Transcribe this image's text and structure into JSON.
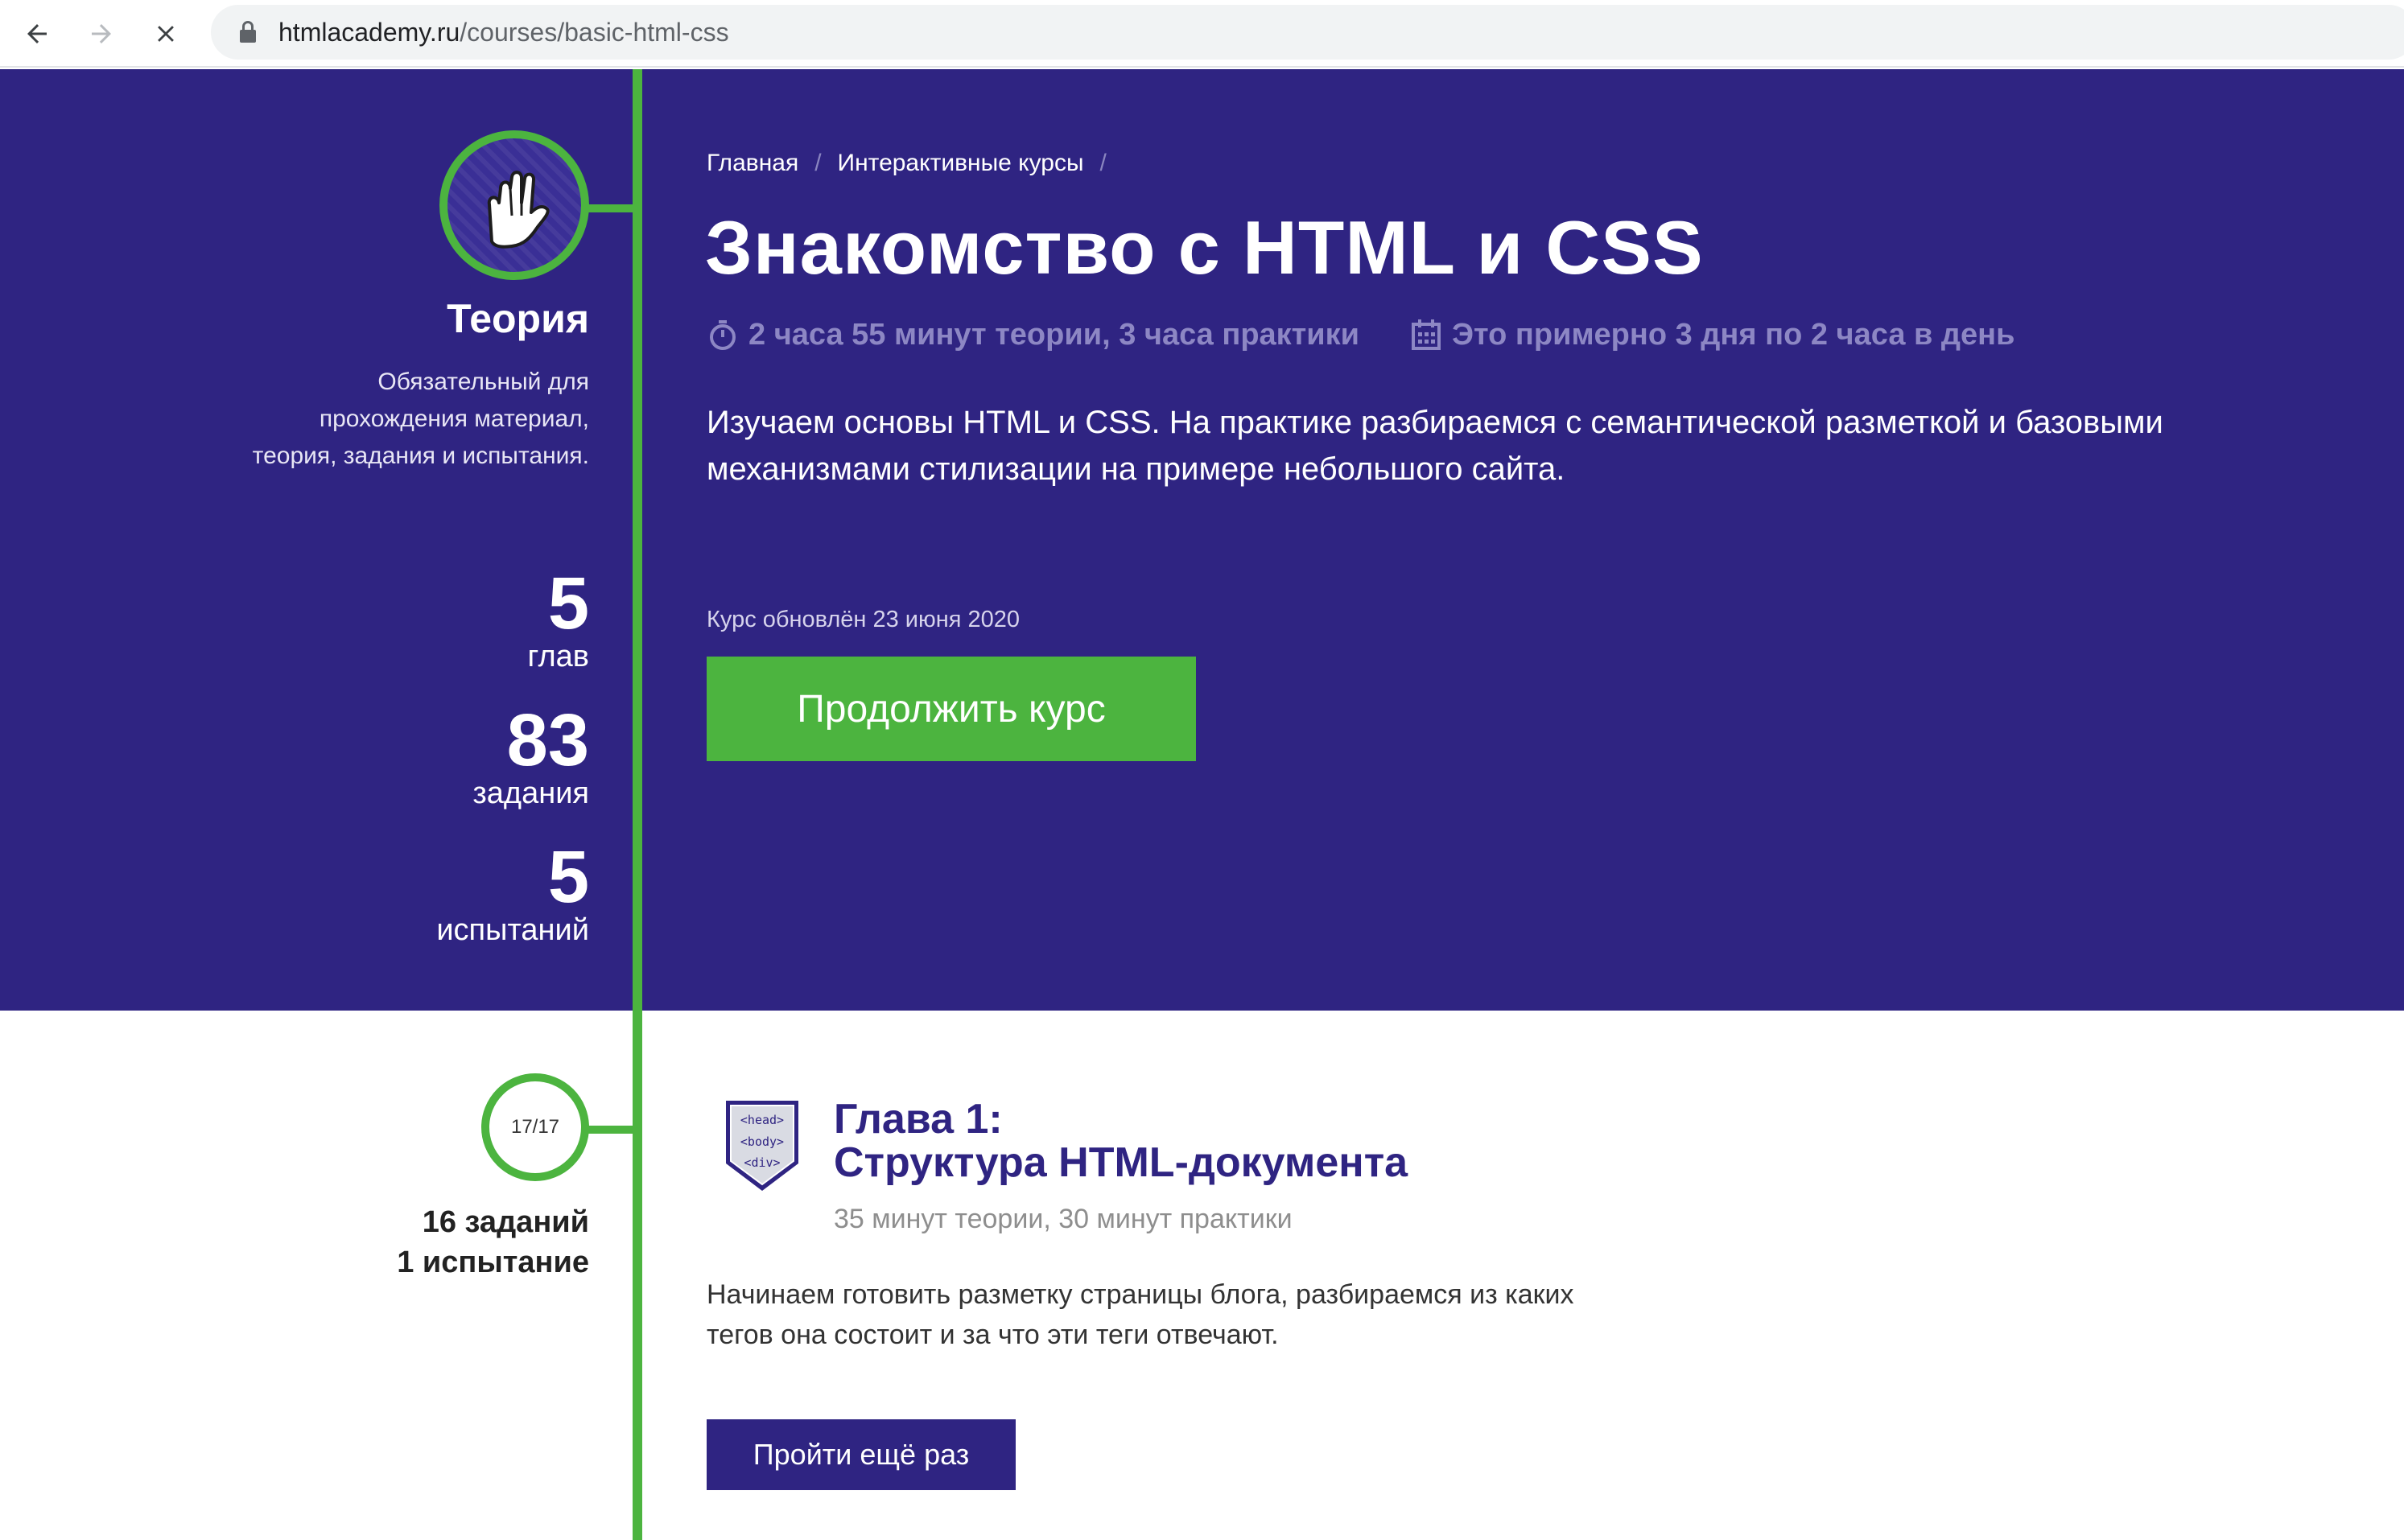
{
  "browser": {
    "url_host": "htmlacademy.ru",
    "url_path": "/courses/basic-html-css",
    "icons": {
      "back": "arrow-left-icon",
      "forward": "arrow-right-icon",
      "stop": "close-icon",
      "secure": "lock-icon"
    }
  },
  "sidebar": {
    "avatar_icon": "vulcan-salute-hand-icon",
    "title": "Теория",
    "description": "Обязательный для прохождения материал, теория, задания и испытания.",
    "stats": [
      {
        "value": "5",
        "label": "глав"
      },
      {
        "value": "83",
        "label": "задания"
      },
      {
        "value": "5",
        "label": "испытаний"
      }
    ]
  },
  "breadcrumb": {
    "items": [
      "Главная",
      "Интерактивные курсы"
    ],
    "separator": "/"
  },
  "course": {
    "title": "Знакомство с HTML и CSS",
    "duration": "2 часа 55 минут теории, 3 часа практики",
    "schedule": "Это примерно 3 дня по 2 часа в день",
    "description": "Изучаем основы HTML и CSS. На практике разбираемся с семантической разметкой и базовыми механизмами стилизации на примере небольшого сайта.",
    "updated": "Курс обновлён 23 июня 2020",
    "continue_label": "Продолжить курс"
  },
  "chapter": {
    "progress": "17/17",
    "tasks": "16 заданий",
    "tests": "1 испытание",
    "title_line1": "Глава 1:",
    "title_line2": "Структура HTML-документа",
    "meta": "35 минут теории, 30 минут практики",
    "description": "Начинаем готовить разметку страницы блога, разбираемся из каких тегов она состоит и за что эти теги отвечают.",
    "replay_label": "Пройти ещё раз",
    "badge_tags": [
      "<head>",
      "<body>",
      "<div>"
    ]
  },
  "colors": {
    "hero_bg": "#2f2482",
    "accent_green": "#4cb43f",
    "muted_purple": "#8d87c4"
  }
}
